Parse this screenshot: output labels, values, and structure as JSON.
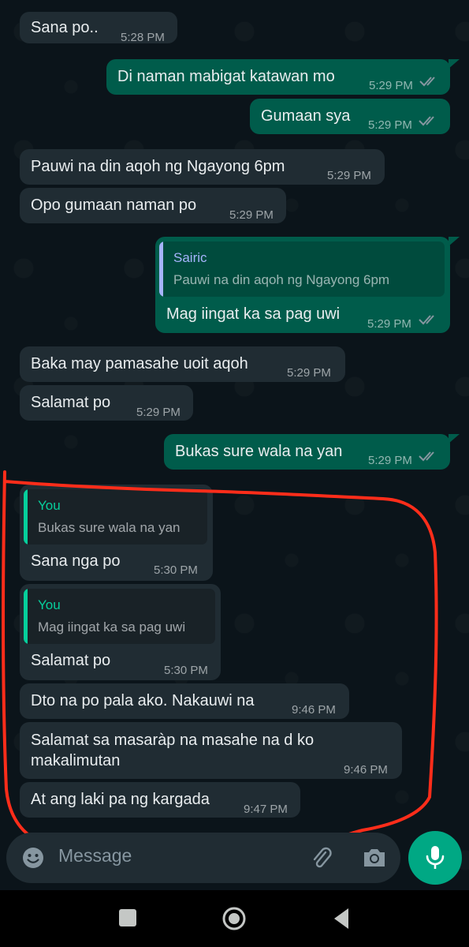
{
  "messages": [
    {
      "dir": "in",
      "text": "Sana po..",
      "time": "5:28 PM"
    },
    {
      "dir": "out",
      "text": "Di naman mabigat katawan mo",
      "time": "5:29 PM"
    },
    {
      "dir": "out",
      "text": "Gumaan sya",
      "time": "5:29 PM"
    },
    {
      "dir": "in",
      "text": "Pauwi na din aqoh ng Ngayong 6pm",
      "time": "5:29 PM"
    },
    {
      "dir": "in",
      "text": "Opo gumaan naman po",
      "time": "5:29 PM"
    },
    {
      "dir": "out",
      "quote_name": "Sairic",
      "quote_text": "Pauwi na din aqoh ng Ngayong 6pm",
      "text": "Mag iingat ka sa pag uwi",
      "time": "5:29 PM"
    },
    {
      "dir": "in",
      "text": "Baka may pamasahe uoit aqoh",
      "time": "5:29 PM"
    },
    {
      "dir": "in",
      "text": "Salamat po",
      "time": "5:29 PM"
    },
    {
      "dir": "out",
      "text": "Bukas sure wala na yan",
      "time": "5:29 PM"
    },
    {
      "dir": "in",
      "quote_name": "You",
      "quote_text": "Bukas sure wala na yan",
      "text": "Sana nga po",
      "time": "5:30 PM"
    },
    {
      "dir": "in",
      "quote_name": "You",
      "quote_text": "Mag iingat ka sa pag uwi",
      "text": "Salamat po",
      "time": "5:30 PM"
    },
    {
      "dir": "in",
      "text": "Dto na po pala ako. Nakauwi na",
      "time": "9:46 PM"
    },
    {
      "dir": "in",
      "text_line1": "Salamat sa masaràp na masahe na d ko",
      "text_line2": "makalimutan",
      "time": "9:46 PM"
    },
    {
      "dir": "in",
      "text": "At ang laki pa ng kargada",
      "time": "9:47 PM"
    }
  ],
  "input": {
    "placeholder": "Message"
  },
  "icons": {
    "emoji": "emoji-icon",
    "attach": "paperclip-icon",
    "camera": "camera-icon",
    "mic": "microphone-icon",
    "read": "double-check-icon",
    "nav_recent": "recent-apps-icon",
    "nav_home": "home-icon",
    "nav_back": "back-icon"
  },
  "colors": {
    "background": "#0b141a",
    "incoming": "#202c33",
    "outgoing": "#005c4b",
    "accent": "#00a884",
    "quote_you": "#06cf9c",
    "quote_sairic": "#a5b4fc",
    "annotation": "#ff2d1a"
  }
}
